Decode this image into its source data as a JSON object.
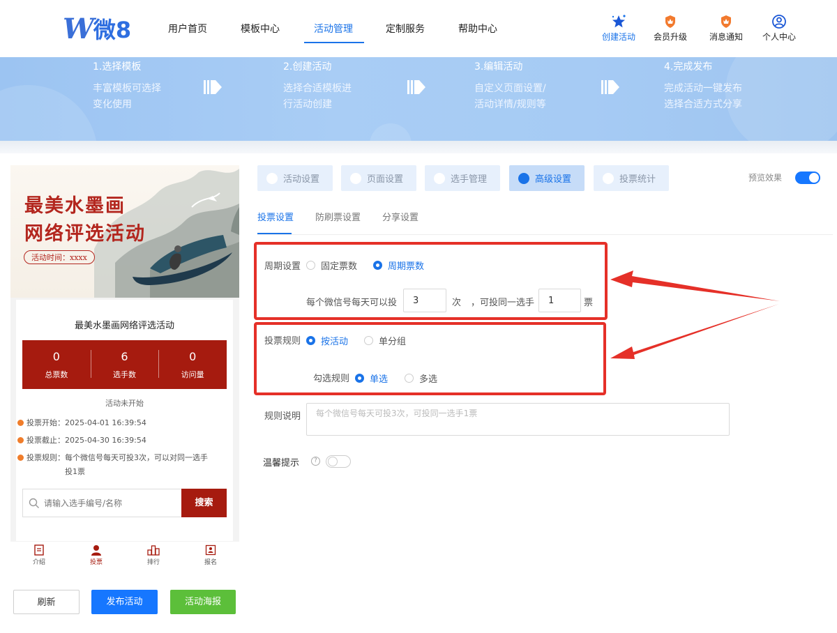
{
  "brand": {
    "logo_text": "微8"
  },
  "nav": {
    "items": [
      {
        "label": "用户首页"
      },
      {
        "label": "模板中心"
      },
      {
        "label": "活动管理",
        "active": true
      },
      {
        "label": "定制服务"
      },
      {
        "label": "帮助中心"
      }
    ],
    "right": [
      {
        "label": "创建活动",
        "icon": "star-icon"
      },
      {
        "label": "会员升级",
        "icon": "crown-icon"
      },
      {
        "label": "消息通知",
        "icon": "bell-icon"
      },
      {
        "label": "个人中心",
        "icon": "user-icon"
      }
    ]
  },
  "steps": [
    {
      "title": "1.选择模板",
      "line1": "丰富模板可选择",
      "line2": "变化使用"
    },
    {
      "title": "2.创建活动",
      "line1": "选择合适模板进",
      "line2": "行活动创建"
    },
    {
      "title": "3.编辑活动",
      "line1": "自定义页面设置/",
      "line2": "活动详情/规则等"
    },
    {
      "title": "4.完成发布",
      "line1": "完成活动一键发布",
      "line2": "选择合适方式分享"
    }
  ],
  "preview": {
    "poster_title_line1": "最美水墨画",
    "poster_title_line2": "网络评选活动",
    "poster_time": "活动时间：xxxx",
    "card_title": "最美水墨画网络评选活动",
    "stats": [
      {
        "value": "0",
        "label": "总票数"
      },
      {
        "value": "6",
        "label": "选手数"
      },
      {
        "value": "0",
        "label": "访问量"
      }
    ],
    "status": "活动未开始",
    "info": [
      {
        "key": "投票开始：",
        "value": "2025-04-01 16:39:54"
      },
      {
        "key": "投票截止：",
        "value": "2025-04-30 16:39:54"
      },
      {
        "key": "投票规则：",
        "value": "每个微信号每天可投3次，可以对同一选手投1票"
      }
    ],
    "search_placeholder": "请输入选手编号/名称",
    "search_button": "搜索",
    "tabs": [
      {
        "label": "介绍"
      },
      {
        "label": "投票",
        "active": true
      },
      {
        "label": "排行"
      },
      {
        "label": "报名"
      }
    ]
  },
  "buttons": {
    "refresh": "刷新",
    "publish": "发布活动",
    "poster": "活动海报"
  },
  "settings_tabs": [
    {
      "label": "活动设置"
    },
    {
      "label": "页面设置"
    },
    {
      "label": "选手管理"
    },
    {
      "label": "高级设置",
      "active": true
    },
    {
      "label": "投票统计"
    }
  ],
  "preview_toggle": {
    "label": "预览效果",
    "on": true
  },
  "sub_tabs": [
    {
      "label": "投票设置",
      "active": true
    },
    {
      "label": "防刷票设置"
    },
    {
      "label": "分享设置"
    }
  ],
  "form": {
    "period_label": "周期设置",
    "period_options": [
      {
        "label": "固定票数",
        "selected": false
      },
      {
        "label": "周期票数",
        "selected": true
      }
    ],
    "per_day_prefix": "每个微信号每天可以投",
    "per_day_value": "3",
    "per_day_unit": "次",
    "same_player_prefix": "，可投同一选手",
    "same_player_value": "1",
    "same_player_unit": "票",
    "rule_label": "投票规则",
    "rule_options": [
      {
        "label": "按活动",
        "selected": true
      },
      {
        "label": "单分组",
        "selected": false
      }
    ],
    "check_label": "勾选规则",
    "check_options": [
      {
        "label": "单选",
        "selected": true
      },
      {
        "label": "多选",
        "selected": false
      }
    ],
    "desc_label": "规则说明",
    "desc_placeholder": "每个微信号每天可投3次，可投同一选手1票",
    "tip_label": "温馨提示",
    "tip_on": false
  },
  "colors": {
    "accent": "#1a73e8",
    "brand_red": "#a61b0f",
    "annotation_red": "#e53028",
    "publish_blue": "#1677ff",
    "poster_green": "#5cbf3a"
  }
}
